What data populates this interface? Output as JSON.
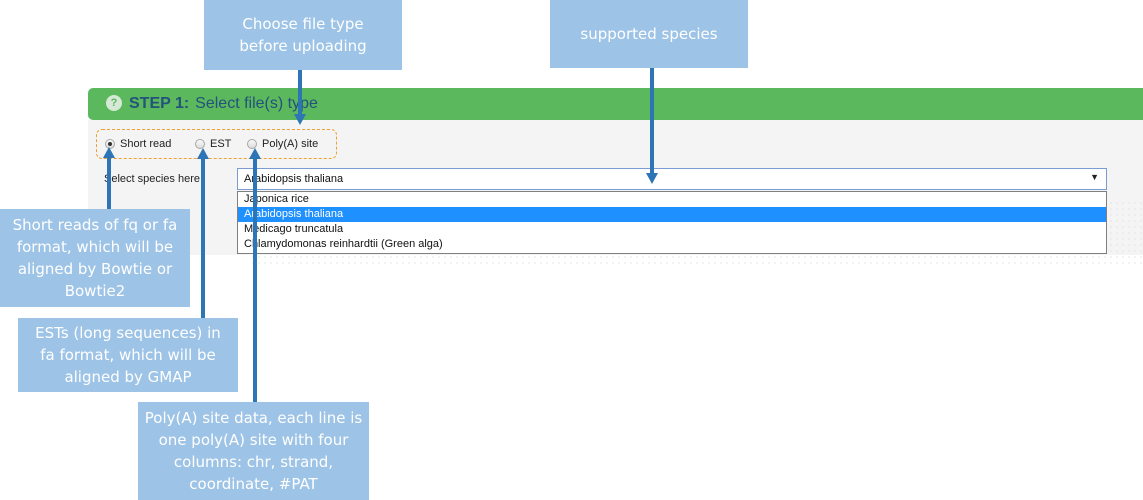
{
  "step": {
    "number": "STEP 1:",
    "title": "Select file(s) type",
    "help_icon_glyph": "?"
  },
  "file_types": [
    {
      "label": "Short read",
      "checked": true
    },
    {
      "label": "EST",
      "checked": false
    },
    {
      "label": "Poly(A) site",
      "checked": false
    }
  ],
  "species": {
    "label": "Select species here:",
    "selected": "Arabidopsis thaliana",
    "caret": "▼",
    "options": [
      "Japonica rice",
      "Arabidopsis thaliana",
      "Medicago truncatula",
      "Chlamydomonas reinhardtii (Green alga)"
    ],
    "highlighted_option": "Arabidopsis thaliana"
  },
  "callouts": {
    "file_type": "Choose file type before uploading",
    "species": "supported species",
    "short_read": "Short reads of fq or fa format, which will be aligned by Bowtie or Bowtie2",
    "est": "ESTs (long sequences) in fa format, which will be aligned by GMAP",
    "polya": "Poly(A) site data, each line is one poly(A) site with four columns: chr, strand, coordinate, #PAT"
  },
  "colors": {
    "header_green": "#5cb85c",
    "callout_fill": "#9dc3e6",
    "arrow_blue": "#2e75b6",
    "radio_group_border": "#f0a030",
    "dropdown_highlight": "#1e90ff"
  }
}
